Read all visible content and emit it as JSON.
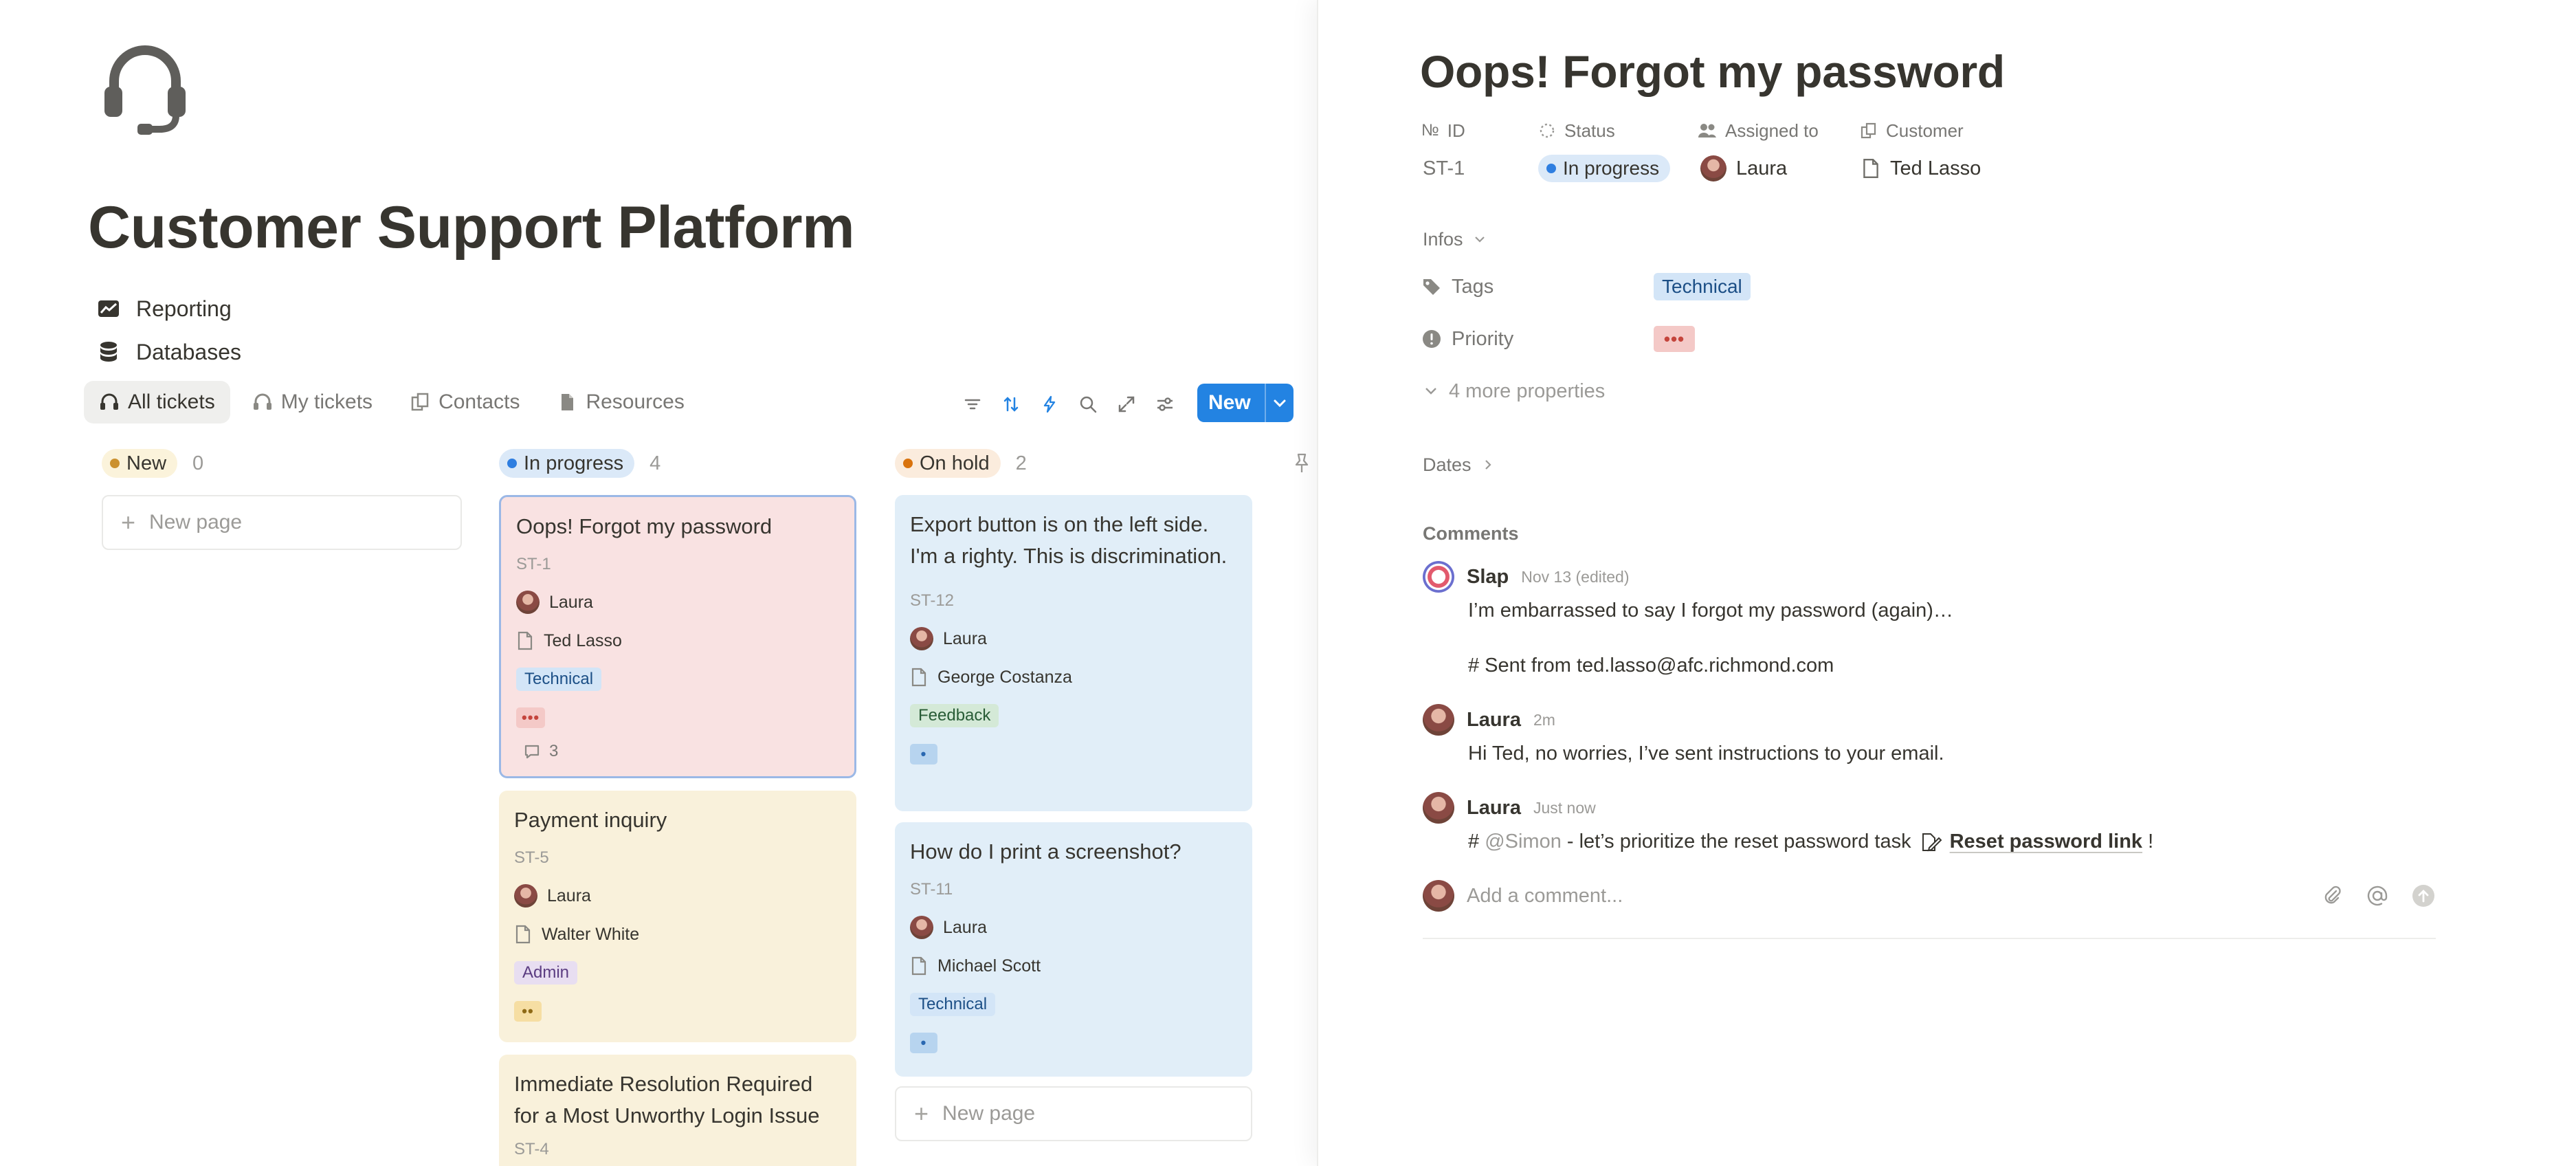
{
  "page": {
    "title": "Customer Support Platform",
    "links": [
      "Reporting",
      "Databases"
    ]
  },
  "views": {
    "tabs": [
      "All tickets",
      "My tickets",
      "Contacts",
      "Resources"
    ],
    "new_label": "New"
  },
  "board": {
    "new_page_label": "New page",
    "columns": [
      {
        "status": "New",
        "count": "0",
        "color": "#cb912f",
        "bg": "#fbf3db"
      },
      {
        "status": "In progress",
        "count": "4",
        "color": "#2e7ee0",
        "bg": "#dbe9f8"
      },
      {
        "status": "On hold",
        "count": "2",
        "color": "#d9730d",
        "bg": "#fbecdd"
      }
    ],
    "cards": {
      "st1": {
        "title": "Oops! Forgot my password",
        "id": "ST-1",
        "assignee": "Laura",
        "customer": "Ted Lasso",
        "tag": "Technical",
        "priority": "•••",
        "comments": "3"
      },
      "st5": {
        "title": "Payment inquiry",
        "id": "ST-5",
        "assignee": "Laura",
        "customer": "Walter White",
        "tag": "Admin",
        "priority": "••"
      },
      "st4": {
        "title": "Immediate Resolution Required for a Most Unworthy Login Issue",
        "id": "ST-4"
      },
      "st12": {
        "title": "Export button is on the left side. I'm a righty. This is discrimination.",
        "id": "ST-12",
        "assignee": "Laura",
        "customer": "George Costanza",
        "tag": "Feedback",
        "priority": "•"
      },
      "st11": {
        "title": "How do I print a screenshot?",
        "id": "ST-11",
        "assignee": "Laura",
        "customer": "Michael Scott",
        "tag": "Technical",
        "priority": "•"
      }
    }
  },
  "detail": {
    "title": "Oops! Forgot my password",
    "props": {
      "id_label": "ID",
      "id_value": "ST-1",
      "status_label": "Status",
      "status_value": "In progress",
      "assigned_label": "Assigned to",
      "assigned_value": "Laura",
      "customer_label": "Customer",
      "customer_value": "Ted Lasso"
    },
    "infos_label": "Infos",
    "tags_label": "Tags",
    "tags_value": "Technical",
    "priority_label": "Priority",
    "priority_value": "•••",
    "more_props": "4 more properties",
    "dates_label": "Dates",
    "comments_label": "Comments",
    "comments": [
      {
        "author": "Slap",
        "time": "Nov 13 (edited)",
        "line1": "I’m embarrassed to say I forgot my password (again)…",
        "line2": "# Sent from ted.lasso@afc.richmond.com"
      },
      {
        "author": "Laura",
        "time": "2m",
        "line1": "Hi Ted, no worries, I’ve sent instructions to your email."
      },
      {
        "author": "Laura",
        "time": "Just now",
        "prefix": "# ",
        "mention": "@Simon",
        "text": " - let’s prioritize the reset password task",
        "link": "Reset password link",
        "suffix": " !"
      }
    ],
    "add_comment_placeholder": "Add a comment..."
  }
}
